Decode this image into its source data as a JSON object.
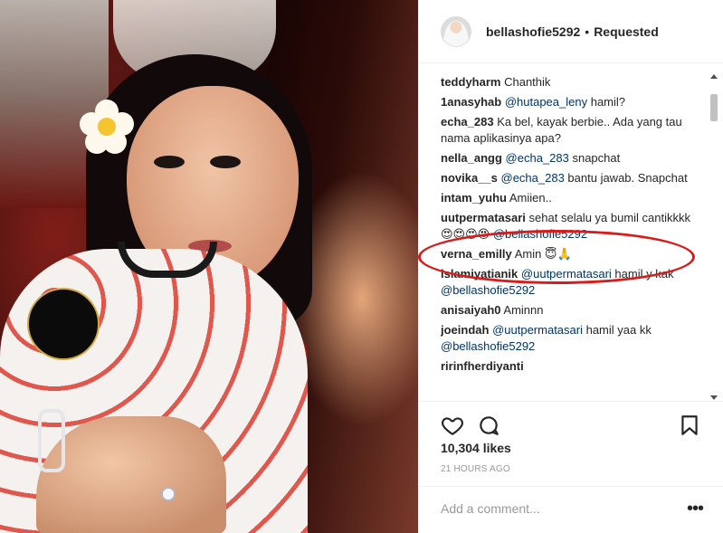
{
  "post": {
    "username": "bellashofie5292",
    "separator": "•",
    "follow_status": "Requested",
    "likes": "10,304 likes",
    "time": "21 HOURS AGO",
    "comment_placeholder": "Add a comment...",
    "more_label": "•••"
  },
  "comments": [
    {
      "user": "teddyharm",
      "parts": [
        {
          "t": "Chanthik"
        }
      ]
    },
    {
      "user": "1anasyhab",
      "parts": [
        {
          "m": "@hutapea_leny"
        },
        {
          "t": " hamil?"
        }
      ]
    },
    {
      "user": "echa_283",
      "parts": [
        {
          "t": "Ka bel, kayak berbie.. Ada yang tau nama aplikasinya apa?"
        }
      ]
    },
    {
      "user": "nella_angg",
      "parts": [
        {
          "m": "@echa_283"
        },
        {
          "t": " snapchat"
        }
      ]
    },
    {
      "user": "novika__s",
      "parts": [
        {
          "m": "@echa_283"
        },
        {
          "t": " bantu jawab. Snapchat"
        }
      ]
    },
    {
      "user": "intam_yuhu",
      "parts": [
        {
          "t": "Amiien.."
        }
      ]
    },
    {
      "user": "uutpermatasari",
      "parts": [
        {
          "t": "sehat selalu ya bumil cantikkkk 😍😍😍😍 "
        },
        {
          "m": "@bellashofie5292"
        }
      ]
    },
    {
      "user": "verna_emilly",
      "parts": [
        {
          "t": "Amin 😇🙏"
        }
      ]
    },
    {
      "user": "islamiyatianik",
      "parts": [
        {
          "m": "@uutpermatasari"
        },
        {
          "t": " hamil y kak "
        },
        {
          "m": "@bellashofie5292"
        }
      ]
    },
    {
      "user": "anisaiyah0",
      "parts": [
        {
          "t": "Aminnn"
        }
      ]
    },
    {
      "user": "joeindah",
      "parts": [
        {
          "m": "@uutpermatasari"
        },
        {
          "t": " hamil yaa kk "
        },
        {
          "m": "@bellashofie5292"
        }
      ]
    },
    {
      "user": "ririnfherdiyanti",
      "parts": [
        {
          "t": ""
        }
      ]
    }
  ],
  "colors": {
    "annotation": "#d81b1b",
    "mention": "#003569",
    "muted": "#999999"
  }
}
